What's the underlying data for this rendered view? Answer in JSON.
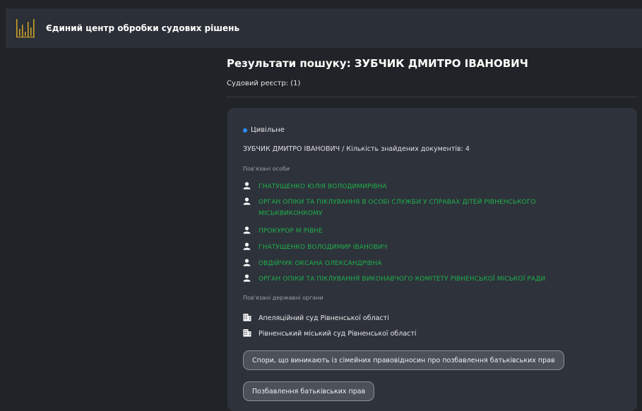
{
  "header": {
    "app_title": "Єдиний центр обробки судових рішень",
    "colors": {
      "bar": "#2b2f37",
      "logo": "#c9a227"
    }
  },
  "main": {
    "title": "Результати пошуку: ЗУБЧИК ДМИТРО ІВАНОВИЧ",
    "registry": "Судовий реєстр: (1)"
  },
  "result": {
    "category": "Цивільне",
    "summary": "ЗУБЧИК ДМИТРО ІВАНОВИЧ / Кількість знайдених документів: 4",
    "related_persons_label": "Пов'язані особи",
    "persons": [
      "ГНАТУЩЕНКО ЮЛІЯ ВОЛОДИМИРІВНА",
      "ОРГАН ОПІКИ ТА ПІКЛУВАННЯ В ОСОБІ СЛУЖБИ У СПРАВАХ ДІТЕЙ РІВНЕНСЬКОГО МІСЬКВИКОНКОМУ",
      "ПРОКУРОР М РІВНЕ",
      "ГНАТУЩЕНКО ВОЛОДИМИР ІВАНОВИЧ",
      "ОВДІЙЧУК ОКСАНА ОЛЕКСАНДРІВНА",
      "ОРГАН ОПІКИ ТА ПІКЛУВАННЯ ВИКОНАВЧОГО КОМІТЕТУ РІВНЕНСЬКОЇ МІСЬКОЇ РАДИ"
    ],
    "related_bodies_label": "Пов'язані державні органи",
    "courts": [
      "Апеляційний суд Рівненської області",
      "Рівненський міський суд Рівненської області"
    ],
    "tags": [
      "Спори, що виникають із сімейних правовідносин про позбавлення батьківських прав",
      "Позбавлення батьківських прав"
    ],
    "colors": {
      "person_link": "#1fb24a",
      "category_dot": "#2e8cff"
    },
    "icons": {
      "person": "person-icon",
      "court": "building-icon"
    }
  }
}
